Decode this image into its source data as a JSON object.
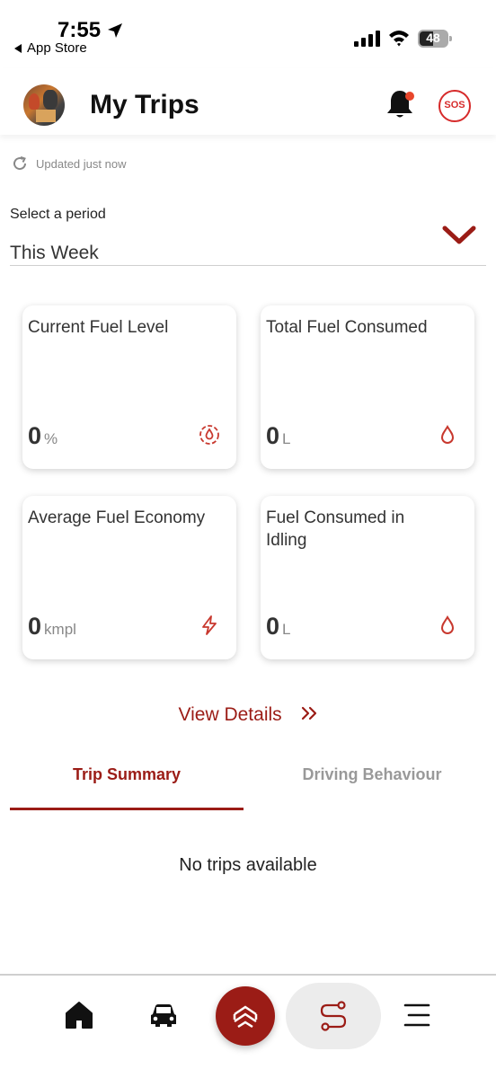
{
  "status_bar": {
    "time": "7:55",
    "back_label": "App Store",
    "battery": "48"
  },
  "header": {
    "title": "My Trips",
    "sos_label": "SOS"
  },
  "updated_text": "Updated just now",
  "period": {
    "label": "Select a period",
    "value": "This Week"
  },
  "cards": [
    {
      "title": "Current Fuel Level",
      "value": "0",
      "unit": "%",
      "icon": "fuel-gauge-icon"
    },
    {
      "title": "Total Fuel Consumed",
      "value": "0",
      "unit": "L",
      "icon": "drop-icon"
    },
    {
      "title": "Average Fuel Economy",
      "value": "0",
      "unit": "kmpl",
      "icon": "lightning-icon"
    },
    {
      "title": "Fuel Consumed in Idling",
      "value": "0",
      "unit": "L",
      "icon": "drop-icon"
    }
  ],
  "view_details": "View Details",
  "tabs": [
    {
      "label": "Trip Summary",
      "active": true
    },
    {
      "label": "Driving Behaviour",
      "active": false
    }
  ],
  "empty_message": "No trips available",
  "bottom_nav": [
    "home-icon",
    "car-icon",
    "brand-logo-icon",
    "route-icon",
    "menu-icon"
  ],
  "colors": {
    "accent": "#9b1c16",
    "sos": "#d62a2a",
    "notification_dot": "#e8462b"
  }
}
